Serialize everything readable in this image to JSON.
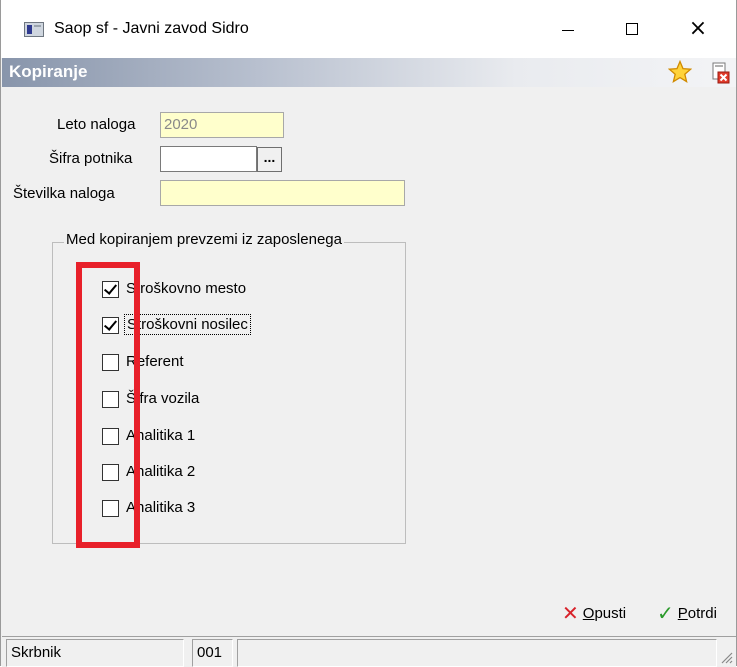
{
  "window": {
    "title": "Saop sf - Javni zavod Sidro",
    "controls": {
      "minimize": "minimize",
      "maximize": "maximize",
      "close": "×"
    }
  },
  "header": {
    "title": "Kopiranje",
    "icons": [
      "star-icon",
      "close-document-icon"
    ],
    "colors": {
      "band_start": "#8895ab",
      "band_end": "#f3f4f6"
    }
  },
  "form": {
    "leto_label": "Leto naloga",
    "leto_value": "2020",
    "sifra_label": "Šifra potnika",
    "sifra_value": "",
    "ellipsis": "...",
    "stevilka_label": "Številka naloga",
    "stevilka_value": ""
  },
  "group": {
    "legend": "Med kopiranjem prevzemi iz zaposlenega",
    "options": [
      {
        "label": "Stroškovno mesto",
        "checked": true
      },
      {
        "label": "Stroškovni nosilec",
        "checked": true
      },
      {
        "label": "Referent",
        "checked": false
      },
      {
        "label": "Šifra vozila",
        "checked": false
      },
      {
        "label": "Analitika 1",
        "checked": false
      },
      {
        "label": "Analitika 2",
        "checked": false
      },
      {
        "label": "Analitika 3",
        "checked": false
      }
    ]
  },
  "highlight": {
    "color": "#e8202a"
  },
  "buttons": {
    "cancel_accel": "O",
    "cancel_rest": "pusti",
    "ok_accel": "P",
    "ok_rest": "otrdi"
  },
  "status": {
    "cell1": "Skrbnik",
    "cell2": "001",
    "cell3": ""
  }
}
